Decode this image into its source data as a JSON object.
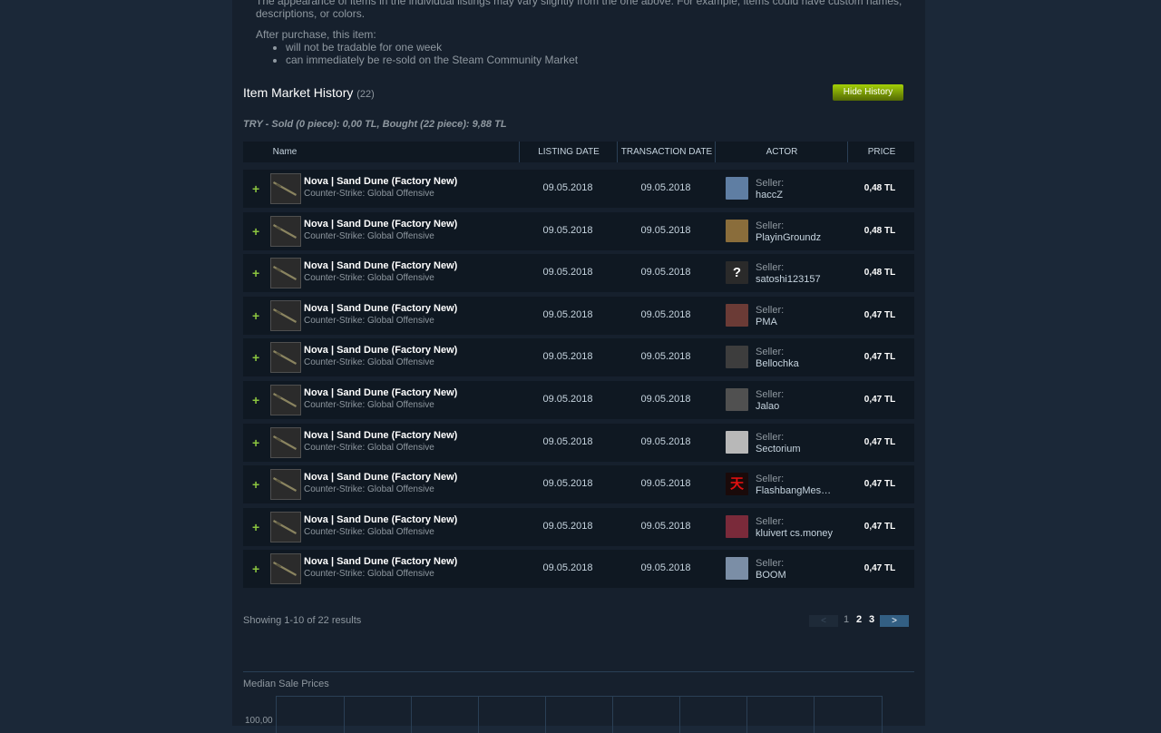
{
  "notice": {
    "line1": "The appearance of items in the individual listings may vary slightly from the one above. For example, items could have custom names,",
    "line2": "descriptions, or colors.",
    "after_title": "After purchase, this item:",
    "bullets": [
      "will not be tradable for one week",
      "can immediately be re-sold on the Steam Community Market"
    ]
  },
  "history": {
    "title": "Item Market History",
    "count": "(22)",
    "hide_label": "Hide History",
    "summary": "TRY - Sold (0 piece): 0,00 TL, Bought (22 piece): 9,88 TL"
  },
  "table": {
    "headers": {
      "name": "Name",
      "listing_date": "LISTING DATE",
      "transaction_date": "TRANSACTION DATE",
      "actor": "ACTOR",
      "price": "PRICE"
    },
    "rows": [
      {
        "plus": "+",
        "item": "Nova | Sand Dune (Factory New)",
        "game": "Counter-Strike: Global Offensive",
        "listing": "09.05.2018",
        "transaction": "09.05.2018",
        "seller_label": "Seller:",
        "seller": "haccZ",
        "price": "0,48 TL",
        "avatar_color": "#5f7ea3"
      },
      {
        "plus": "+",
        "item": "Nova | Sand Dune (Factory New)",
        "game": "Counter-Strike: Global Offensive",
        "listing": "09.05.2018",
        "transaction": "09.05.2018",
        "seller_label": "Seller:",
        "seller": "PlayinGroundz",
        "price": "0,48 TL",
        "avatar_color": "#8a6d3b"
      },
      {
        "plus": "+",
        "item": "Nova | Sand Dune (Factory New)",
        "game": "Counter-Strike: Global Offensive",
        "listing": "09.05.2018",
        "transaction": "09.05.2018",
        "seller_label": "Seller:",
        "seller": "satoshi123157",
        "price": "0,48 TL",
        "avatar_color": "#2a2a2a",
        "avatar_text": "?"
      },
      {
        "plus": "+",
        "item": "Nova | Sand Dune (Factory New)",
        "game": "Counter-Strike: Global Offensive",
        "listing": "09.05.2018",
        "transaction": "09.05.2018",
        "seller_label": "Seller:",
        "seller": "PMA",
        "price": "0,47 TL",
        "avatar_color": "#6b3b36"
      },
      {
        "plus": "+",
        "item": "Nova | Sand Dune (Factory New)",
        "game": "Counter-Strike: Global Offensive",
        "listing": "09.05.2018",
        "transaction": "09.05.2018",
        "seller_label": "Seller:",
        "seller": "Bellochka",
        "price": "0,47 TL",
        "avatar_color": "#3d3d3d"
      },
      {
        "plus": "+",
        "item": "Nova | Sand Dune (Factory New)",
        "game": "Counter-Strike: Global Offensive",
        "listing": "09.05.2018",
        "transaction": "09.05.2018",
        "seller_label": "Seller:",
        "seller": "Jalao",
        "price": "0,47 TL",
        "avatar_color": "#505050"
      },
      {
        "plus": "+",
        "item": "Nova | Sand Dune (Factory New)",
        "game": "Counter-Strike: Global Offensive",
        "listing": "09.05.2018",
        "transaction": "09.05.2018",
        "seller_label": "Seller:",
        "seller": "Sectorium",
        "price": "0,47 TL",
        "avatar_color": "#b8b8b8"
      },
      {
        "plus": "+",
        "item": "Nova | Sand Dune (Factory New)",
        "game": "Counter-Strike: Global Offensive",
        "listing": "09.05.2018",
        "transaction": "09.05.2018",
        "seller_label": "Seller:",
        "seller": "FlashbangMes…",
        "price": "0,47 TL",
        "avatar_color": "#1a0a0a",
        "avatar_text": "天"
      },
      {
        "plus": "+",
        "item": "Nova | Sand Dune (Factory New)",
        "game": "Counter-Strike: Global Offensive",
        "listing": "09.05.2018",
        "transaction": "09.05.2018",
        "seller_label": "Seller:",
        "seller": "kluivert cs.money",
        "price": "0,47 TL",
        "avatar_color": "#7a2a3a"
      },
      {
        "plus": "+",
        "item": "Nova | Sand Dune (Factory New)",
        "game": "Counter-Strike: Global Offensive",
        "listing": "09.05.2018",
        "transaction": "09.05.2018",
        "seller_label": "Seller:",
        "seller": "BOOM",
        "price": "0,47 TL",
        "avatar_color": "#7b8ea6"
      }
    ]
  },
  "pagination": {
    "showing": "Showing 1-10 of 22 results",
    "prev": "<",
    "pages": [
      "1",
      "2",
      "3"
    ],
    "next": ">"
  },
  "median": {
    "title": "Median Sale Prices",
    "y_top_label": "100,00"
  }
}
